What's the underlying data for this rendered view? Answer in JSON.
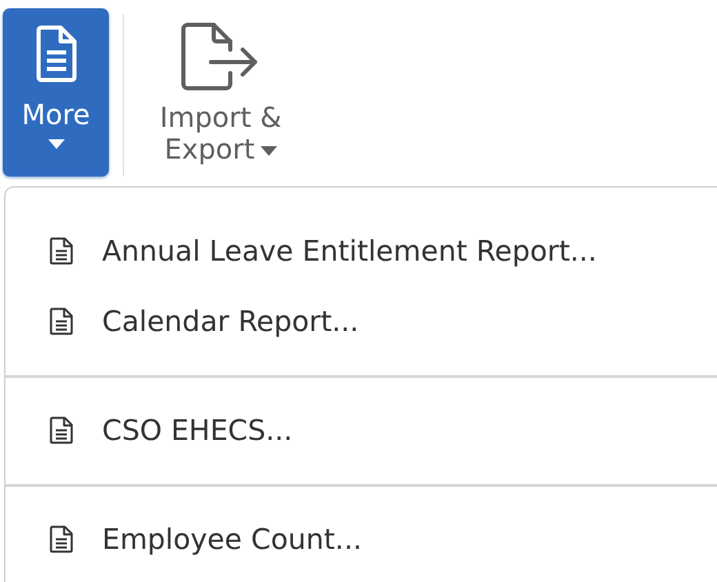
{
  "toolbar": [
    {
      "kind": "document",
      "label": "More",
      "selected": true
    },
    {
      "kind": "export",
      "label": "Import & Export",
      "selected": false
    }
  ],
  "menu": {
    "groups": [
      {
        "items": [
          {
            "label": "Annual Leave Entitlement Report..."
          },
          {
            "label": "Calendar Report..."
          }
        ]
      },
      {
        "items": [
          {
            "label": "CSO EHECS..."
          }
        ]
      },
      {
        "items": [
          {
            "label": "Employee Count..."
          }
        ]
      }
    ]
  }
}
